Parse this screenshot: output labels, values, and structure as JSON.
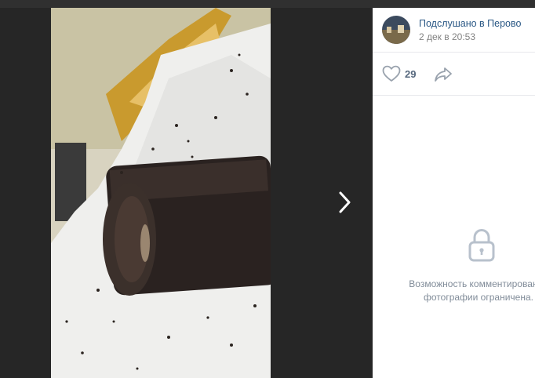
{
  "post": {
    "group_name": "Подслушано в Перово",
    "date": "2 дек в 20:53",
    "likes": "29"
  },
  "comments": {
    "restricted_line1": "Возможность комментирования",
    "restricted_line2": "фотографии ограничена."
  },
  "icons": {
    "like": "heart-icon",
    "share": "share-arrow-icon",
    "next": "chevron-right-icon",
    "lock": "lock-icon"
  },
  "colors": {
    "link": "#2a5885",
    "muted": "#828282",
    "icon": "#99a2ad"
  }
}
